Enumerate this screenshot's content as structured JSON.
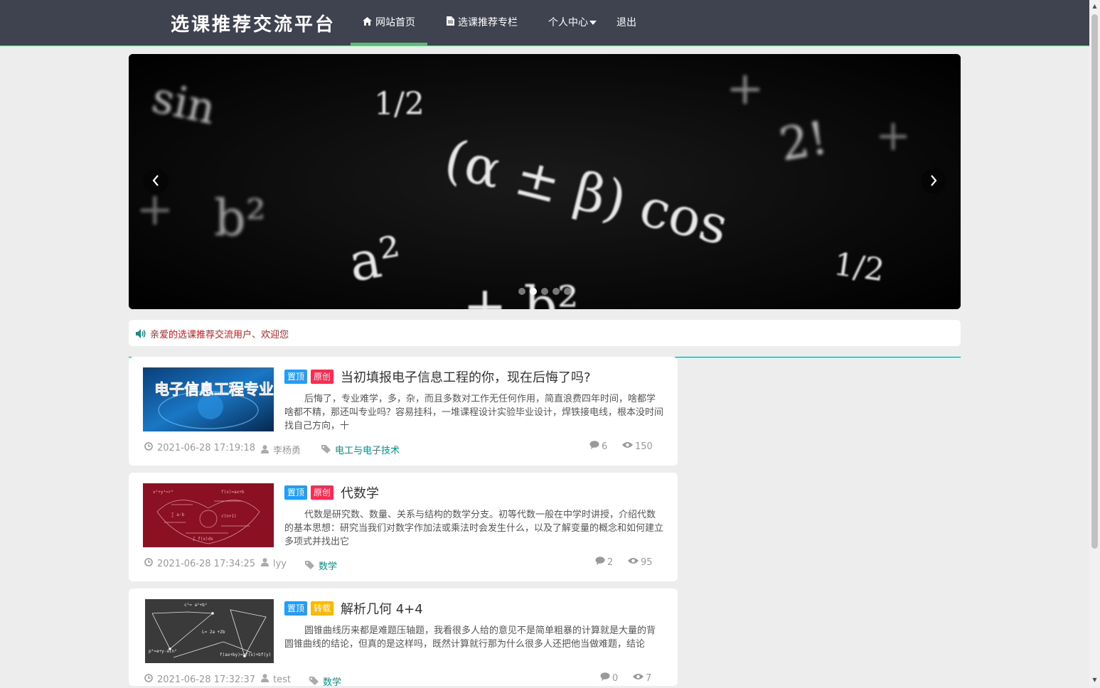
{
  "header": {
    "brand": "选课推荐交流平台",
    "nav": [
      {
        "label": "网站首页",
        "icon": "home-icon",
        "active": true
      },
      {
        "label": "选课推荐专栏",
        "icon": "document-icon"
      },
      {
        "label": "个人中心",
        "icon": "caret-down-icon"
      },
      {
        "label": "退出"
      }
    ],
    "accent": "#5fb878"
  },
  "carousel": {
    "slide_count": 5,
    "active_index": 1,
    "image": "math-formula-banner",
    "formula_text": {
      "sin": "sin",
      "alpha_beta": "(α ± β) cos",
      "a2": "a²",
      "b2": "b²",
      "plus_b2": "+ b²",
      "half": "1/2",
      "factorial": "2!"
    }
  },
  "notice": {
    "icon": "speaker-icon",
    "text": "亲爱的选课推荐交流用户、欢迎您",
    "color": "#d41a1a"
  },
  "articles": [
    {
      "badges": [
        "置顶",
        "原创"
      ],
      "title": "当初填报电子信息工程的你，现在后悔了吗?",
      "summary": "后悔了，专业难学，多，杂，而且多数对工作无任何作用，简直浪费四年时间，啥都学啥都不精，那还叫专业吗？容易挂科，一堆课程设计实验毕业设计，焊铁接电线，根本没时间找自己方向，十",
      "date": "2021-06-28 17:19:18",
      "author": "李杨勇",
      "category": "电工与电子技术",
      "comments": "6",
      "views": "150",
      "thumb_text": "电子信息工程专业"
    },
    {
      "badges": [
        "置顶",
        "原创"
      ],
      "title": "代数学",
      "summary": "代数是研究数、数量、关系与结构的数学分支。初等代数一般在中学时讲授，介绍代数的基本思想：研究当我们对数字作加法或乘法时会发生什么，以及了解变量的概念和如何建立多项式并找出它",
      "date": "2021-06-28 17:34:25",
      "author": "lyy",
      "category": "数学",
      "comments": "2",
      "views": "95"
    },
    {
      "badges": [
        "置顶",
        "转载"
      ],
      "title": "解析几何 4+4",
      "summary": "圆锥曲线历来都是难题压轴题，我看很多人给的意见不是简单粗暴的计算就是大量的背圆锥曲线的结论，但真的是这样吗，既然计算就行那为什么很多人还把他当做难题，结论",
      "date": "2021-06-28 17:32:37",
      "author": "test",
      "category": "数学",
      "comments": "0",
      "views": "7"
    }
  ]
}
